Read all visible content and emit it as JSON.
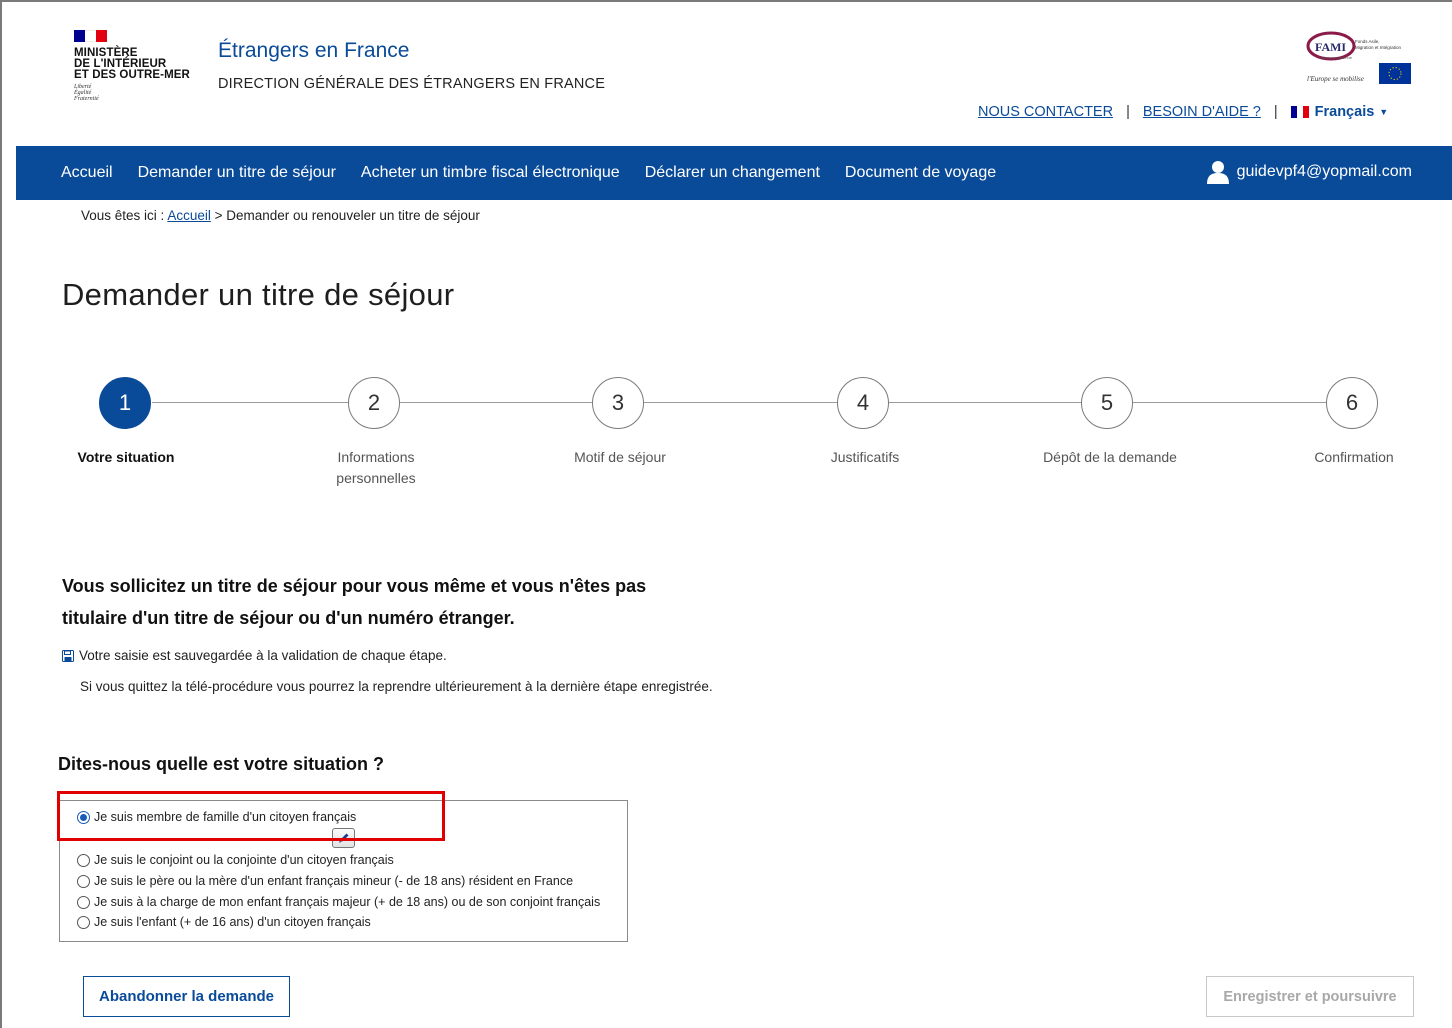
{
  "header": {
    "ministry_lines": [
      "MINISTÈRE",
      "DE L'INTÉRIEUR",
      "ET DES OUTRE-MER"
    ],
    "devise_lines": [
      "Liberté",
      "Égalité",
      "Fraternité"
    ],
    "site_title": "Étrangers en France",
    "site_subtitle": "DIRECTION GÉNÉRALE DES ÉTRANGERS EN FRANCE",
    "fami_logo": {
      "name": "FAMI",
      "lines": [
        "Fonds Asile,",
        "Migration et Intégration"
      ],
      "union": "Union européenne",
      "tagline": "l'Europe se mobilise"
    },
    "links": {
      "contact": "NOUS CONTACTER",
      "help": "BESOIN D'AIDE ?",
      "separator": "|",
      "language": "Français"
    }
  },
  "nav": {
    "items": [
      "Accueil",
      "Demander un titre de séjour",
      "Acheter un timbre fiscal électronique",
      "Déclarer un changement",
      "Document de voyage"
    ],
    "user_email": "guidevpf4@yopmail.com"
  },
  "breadcrumb": {
    "prefix": "Vous êtes ici :",
    "home": "Accueil",
    "rest": "> Demander ou renouveler un titre de séjour"
  },
  "page_title": "Demander un titre de séjour",
  "stepper": {
    "steps": [
      {
        "number": "1",
        "label": "Votre situation",
        "active": true
      },
      {
        "number": "2",
        "label": "Informations personnelles",
        "active": false
      },
      {
        "number": "3",
        "label": "Motif de séjour",
        "active": false
      },
      {
        "number": "4",
        "label": "Justificatifs",
        "active": false
      },
      {
        "number": "5",
        "label": "Dépôt de la demande",
        "active": false
      },
      {
        "number": "6",
        "label": "Confirmation",
        "active": false
      }
    ]
  },
  "intro": {
    "line1": "Vous sollicitez un titre de séjour pour vous même et vous n'êtes pas",
    "line2": "titulaire d'un titre de séjour ou d'un numéro étranger.",
    "save_note": "Votre saisie est sauvegardée à la validation de chaque étape.",
    "resume_note": "Si vous quittez la télé-procédure vous pourrez la reprendre ultérieurement à la dernière étape enregistrée."
  },
  "situation": {
    "question": "Dites-nous quelle est votre situation ?",
    "options": [
      {
        "label": "Je suis membre de famille d'un citoyen français",
        "selected": true
      },
      {
        "label": "Je suis le conjoint ou la conjointe d'un citoyen français",
        "selected": false
      },
      {
        "label": "Je suis le père ou la mère d'un enfant français mineur (- de 18 ans) résident en France",
        "selected": false
      },
      {
        "label": "Je suis à la charge de mon enfant français majeur (+ de 18 ans) ou de son conjoint français",
        "selected": false
      },
      {
        "label": "Je suis l'enfant (+ de 16 ans) d'un citoyen français",
        "selected": false
      }
    ]
  },
  "buttons": {
    "abandon": "Abandonner la demande",
    "next": "Enregistrer et poursuivre"
  },
  "colors": {
    "primary": "#0a4b99",
    "highlight": "#e00000",
    "flag_blue": "#000091",
    "flag_red": "#e1000f"
  }
}
